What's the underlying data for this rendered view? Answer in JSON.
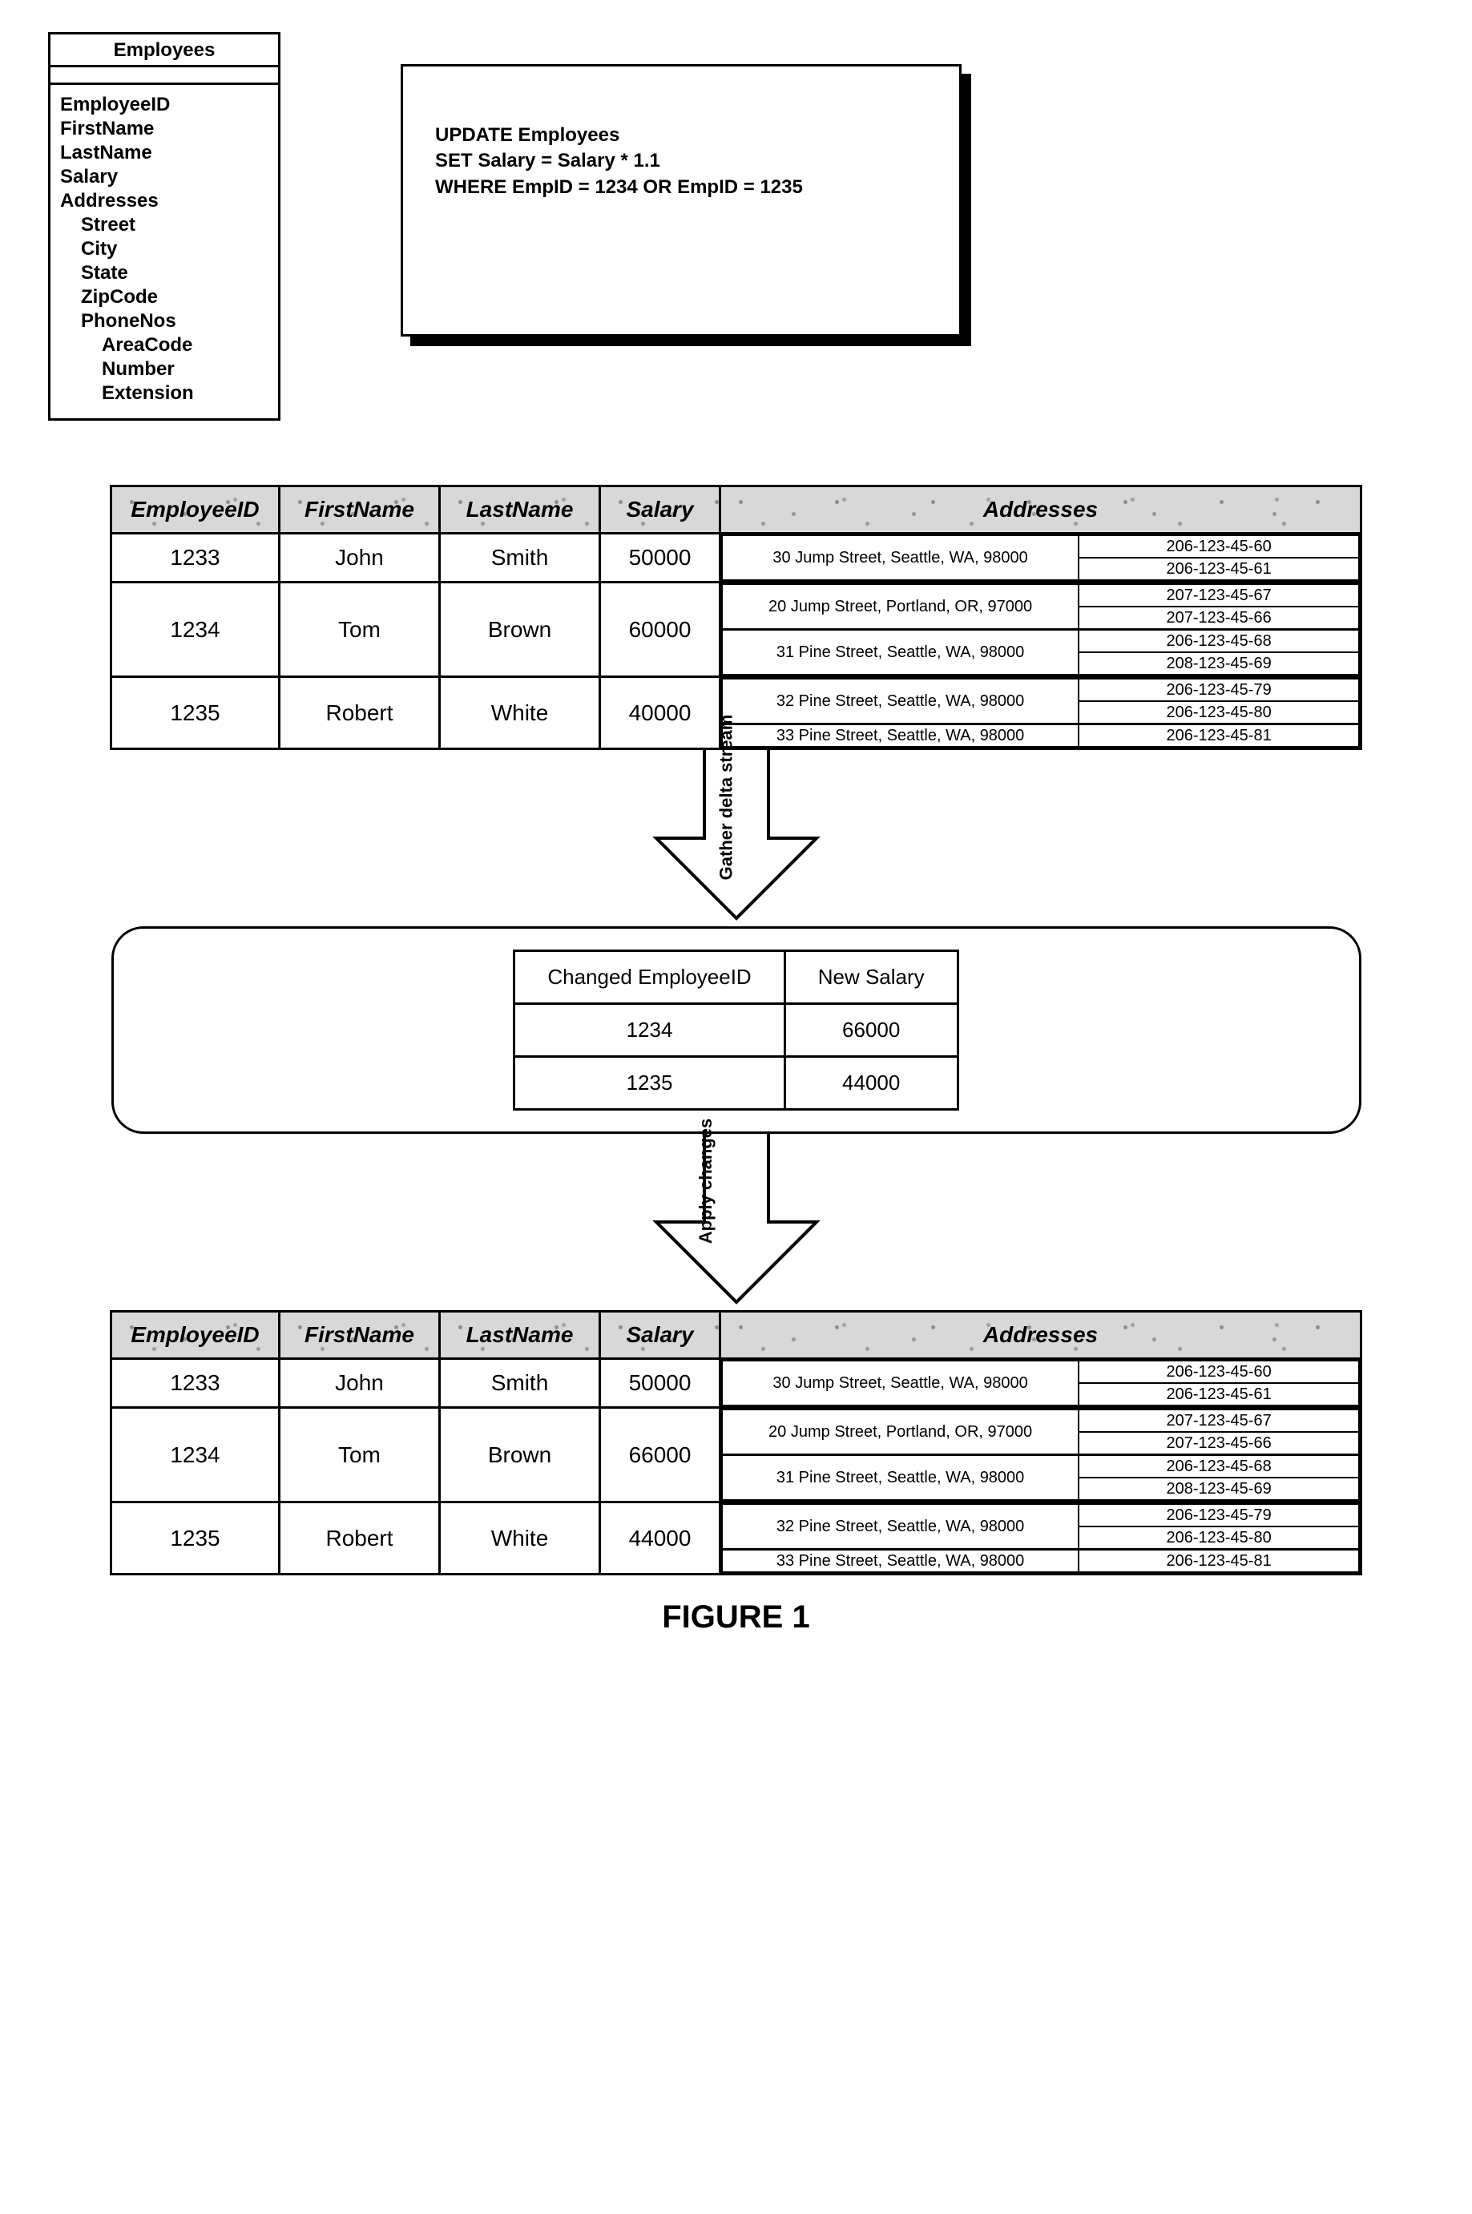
{
  "schema": {
    "title": "Employees",
    "fields": [
      {
        "name": "EmployeeID",
        "indent": 0
      },
      {
        "name": "FirstName",
        "indent": 0
      },
      {
        "name": "LastName",
        "indent": 0
      },
      {
        "name": "Salary",
        "indent": 0
      },
      {
        "name": "Addresses",
        "indent": 0
      },
      {
        "name": "Street",
        "indent": 1
      },
      {
        "name": "City",
        "indent": 1
      },
      {
        "name": "State",
        "indent": 1
      },
      {
        "name": "ZipCode",
        "indent": 1
      },
      {
        "name": "PhoneNos",
        "indent": 1
      },
      {
        "name": "AreaCode",
        "indent": 2
      },
      {
        "name": "Number",
        "indent": 2
      },
      {
        "name": "Extension",
        "indent": 2
      }
    ]
  },
  "sql": {
    "line1": "UPDATE Employees",
    "line2": "SET Salary = Salary * 1.1",
    "line3": "WHERE EmpID = 1234 OR EmpID = 1235"
  },
  "headers": {
    "empid": "EmployeeID",
    "fname": "FirstName",
    "lname": "LastName",
    "salary": "Salary",
    "addr": "Addresses"
  },
  "employees_before": [
    {
      "id": "1233",
      "first": "John",
      "last": "Smith",
      "salary": "50000",
      "addrs": [
        {
          "street": "30 Jump Street, Seattle, WA, 98000",
          "phones": [
            "206-123-45-60",
            "206-123-45-61"
          ]
        }
      ]
    },
    {
      "id": "1234",
      "first": "Tom",
      "last": "Brown",
      "salary": "60000",
      "addrs": [
        {
          "street": "20 Jump Street, Portland, OR, 97000",
          "phones": [
            "207-123-45-67",
            "207-123-45-66"
          ]
        },
        {
          "street": "31 Pine Street, Seattle, WA, 98000",
          "phones": [
            "206-123-45-68",
            "208-123-45-69"
          ]
        }
      ]
    },
    {
      "id": "1235",
      "first": "Robert",
      "last": "White",
      "salary": "40000",
      "addrs": [
        {
          "street": "32 Pine Street, Seattle, WA, 98000",
          "phones": [
            "206-123-45-79",
            "206-123-45-80"
          ]
        },
        {
          "street": "33 Pine Street, Seattle, WA, 98000",
          "phones": [
            "206-123-45-81"
          ]
        }
      ]
    }
  ],
  "arrow1_label": "Gather delta stream",
  "delta": {
    "h1": "Changed EmployeeID",
    "h2": "New Salary",
    "rows": [
      {
        "id": "1234",
        "salary": "66000"
      },
      {
        "id": "1235",
        "salary": "44000"
      }
    ]
  },
  "arrow2_label": "Apply changes",
  "employees_after": [
    {
      "id": "1233",
      "first": "John",
      "last": "Smith",
      "salary": "50000",
      "addrs": [
        {
          "street": "30 Jump Street, Seattle, WA, 98000",
          "phones": [
            "206-123-45-60",
            "206-123-45-61"
          ]
        }
      ]
    },
    {
      "id": "1234",
      "first": "Tom",
      "last": "Brown",
      "salary": "66000",
      "addrs": [
        {
          "street": "20 Jump Street, Portland, OR, 97000",
          "phones": [
            "207-123-45-67",
            "207-123-45-66"
          ]
        },
        {
          "street": "31 Pine Street, Seattle, WA, 98000",
          "phones": [
            "206-123-45-68",
            "208-123-45-69"
          ]
        }
      ]
    },
    {
      "id": "1235",
      "first": "Robert",
      "last": "White",
      "salary": "44000",
      "addrs": [
        {
          "street": "32 Pine Street, Seattle, WA, 98000",
          "phones": [
            "206-123-45-79",
            "206-123-45-80"
          ]
        },
        {
          "street": "33 Pine Street, Seattle, WA, 98000",
          "phones": [
            "206-123-45-81"
          ]
        }
      ]
    }
  ],
  "caption": "FIGURE 1"
}
